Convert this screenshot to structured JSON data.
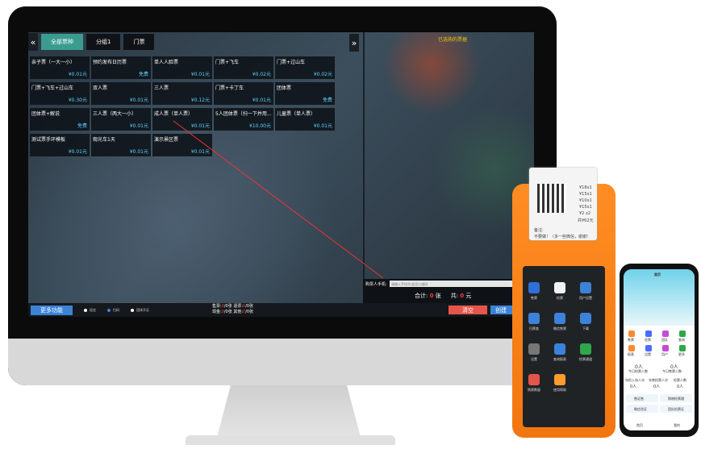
{
  "screen": {
    "tabs": [
      {
        "label": "全部票种",
        "active": true
      },
      {
        "label": "分组1",
        "active": false
      },
      {
        "label": "门票",
        "active": false
      }
    ],
    "right_title": "已选购的票据",
    "tickets": [
      {
        "name": "亲子票（一大一小）",
        "price": "¥0.01元",
        "tag": "",
        "note": ""
      },
      {
        "name": "预约发布日历票",
        "price": "免费",
        "tag": "",
        "note": ""
      },
      {
        "name": "单人人脸票",
        "price": "¥0.01元",
        "tag": "",
        "note": ""
      },
      {
        "name": "门票+飞车",
        "price": "¥0.02元",
        "tag": "",
        "note": ""
      },
      {
        "name": "门票+过山车",
        "price": "¥0.02元",
        "tag": "",
        "note": ""
      },
      {
        "name": "门票+飞车+过山车",
        "price": "¥0.30元",
        "tag": "",
        "note": ""
      },
      {
        "name": "双人票",
        "price": "¥0.01元",
        "tag": "",
        "note": ""
      },
      {
        "name": "三人票",
        "price": "¥0.12元",
        "tag": "",
        "note": ""
      },
      {
        "name": "门票+卡丁车",
        "price": "¥0.01元",
        "tag": "",
        "note": ""
      },
      {
        "name": "团体票",
        "price": "免费",
        "tag": "",
        "note": ""
      },
      {
        "name": "团体票+解说",
        "price": "免费",
        "tag": "",
        "note": ""
      },
      {
        "name": "三人票（两大一小）",
        "price": "¥0.01元",
        "tag": "",
        "note": ""
      },
      {
        "name": "成人票（单人票）",
        "price": "¥0.01元",
        "tag": "",
        "note": ""
      },
      {
        "name": "5人团体票（扫一下并用...",
        "price": "¥10.00元",
        "tag": "",
        "note": ""
      },
      {
        "name": "儿童票（单人票）",
        "price": "¥0.01元",
        "tag": "",
        "note": ""
      },
      {
        "name": "测试票手环模板",
        "price": "¥0.01元",
        "tag": "",
        "note": ""
      },
      {
        "name": "观光车1天",
        "price": "¥0.01元",
        "tag": "",
        "note": ""
      },
      {
        "name": "演示景区票",
        "price": "¥0.01元",
        "tag": "",
        "note": ""
      }
    ],
    "buyer_label": "购票人手机:",
    "buyer_placeholder": "请输入手机号/会员二维码",
    "total_label": "合计:",
    "total_count": "0",
    "total_count_unit": "张",
    "total_sum_label": "共:",
    "total_sum": "0",
    "total_sum_unit": "元",
    "more_label": "更多功能",
    "radios": [
      "现金",
      "扫码",
      "团体开证"
    ],
    "stats": {
      "line1_a": "售票:",
      "line1_a_val": "0",
      "line1_a_unit": "/0张",
      "line1_b": "退票:",
      "line1_b_val": "0",
      "line1_b_unit": "/0张",
      "line2_a": "现金:",
      "line2_a_val": "0",
      "line2_a_unit": "/0张",
      "line2_b": "其他:",
      "line2_b_val": "0",
      "line2_b_unit": "/0张"
    },
    "clear_label": "清空",
    "create_label": "创建"
  },
  "pos": {
    "receipt_lines": [
      "¥18x1",
      "¥15x1",
      "¥10x1",
      "¥15x1",
      "¥2 x2",
      "共¥62元"
    ],
    "receipt_note": "备注:",
    "receipt_msg": "不要做！（多一些微信，谢谢!",
    "apps": [
      "售票",
      "检票",
      "用户设置",
      "扫票查",
      "微信售票",
      "下载",
      "设置",
      "查询报表",
      "检票通道",
      "购票数量",
      "使用帮助"
    ]
  },
  "phone": {
    "title": "首页",
    "icons": [
      "售票",
      "验票",
      "团队",
      "查询",
      "报表",
      "设置",
      "用户",
      "更多"
    ],
    "cards": [
      {
        "value": "0人",
        "label": "今日检票人数"
      },
      {
        "value": "0人",
        "label": "今日售票人数"
      }
    ],
    "mini_stats": [
      {
        "label": "年检入场人次",
        "value": "0人"
      },
      {
        "label": "年售检票人次",
        "value": "0人"
      },
      {
        "label": "检票人数",
        "value": "0人"
      }
    ],
    "buttons": [
      "售证售",
      "购物检票通",
      "微信验证",
      "团队检票证"
    ],
    "nav": [
      "首页",
      "我的"
    ]
  }
}
